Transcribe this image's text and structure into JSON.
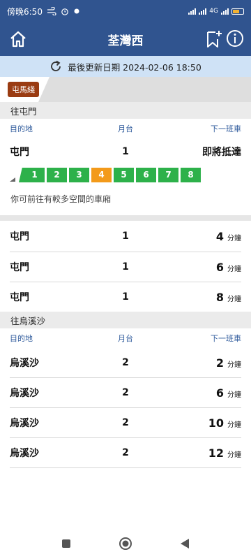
{
  "status_bar": {
    "time": "傍晚6:50",
    "net": "4G"
  },
  "header": {
    "title": "荃灣西"
  },
  "update": {
    "text": "最後更新日期 2024-02-06 18:50"
  },
  "line": {
    "name": "屯馬綫",
    "color": "#9a3b12"
  },
  "sections": [
    {
      "title": "往屯門",
      "col_dest": "目的地",
      "col_platform": "月台",
      "col_next": "下一班車",
      "first": {
        "dest": "屯門",
        "platform": "1",
        "next": "即將抵達"
      },
      "cars": [
        "1",
        "2",
        "3",
        "4",
        "5",
        "6",
        "7",
        "8"
      ],
      "busy_car": "4",
      "hint": "你可前往有較多空間的車廂",
      "rows": [
        {
          "dest": "屯門",
          "platform": "1",
          "min": "4",
          "unit": "分鐘"
        },
        {
          "dest": "屯門",
          "platform": "1",
          "min": "6",
          "unit": "分鐘"
        },
        {
          "dest": "屯門",
          "platform": "1",
          "min": "8",
          "unit": "分鐘"
        }
      ]
    },
    {
      "title": "往烏溪沙",
      "col_dest": "目的地",
      "col_platform": "月台",
      "col_next": "下一班車",
      "rows": [
        {
          "dest": "烏溪沙",
          "platform": "2",
          "min": "2",
          "unit": "分鐘"
        },
        {
          "dest": "烏溪沙",
          "platform": "2",
          "min": "6",
          "unit": "分鐘"
        },
        {
          "dest": "烏溪沙",
          "platform": "2",
          "min": "10",
          "unit": "分鐘"
        },
        {
          "dest": "烏溪沙",
          "platform": "2",
          "min": "12",
          "unit": "分鐘"
        }
      ]
    }
  ],
  "colors": {
    "header": "#30548f",
    "update_bar": "#cfe2f6",
    "car_normal": "#2db14a",
    "car_busy": "#f39a1a",
    "header_text": "#2f5b9c"
  }
}
